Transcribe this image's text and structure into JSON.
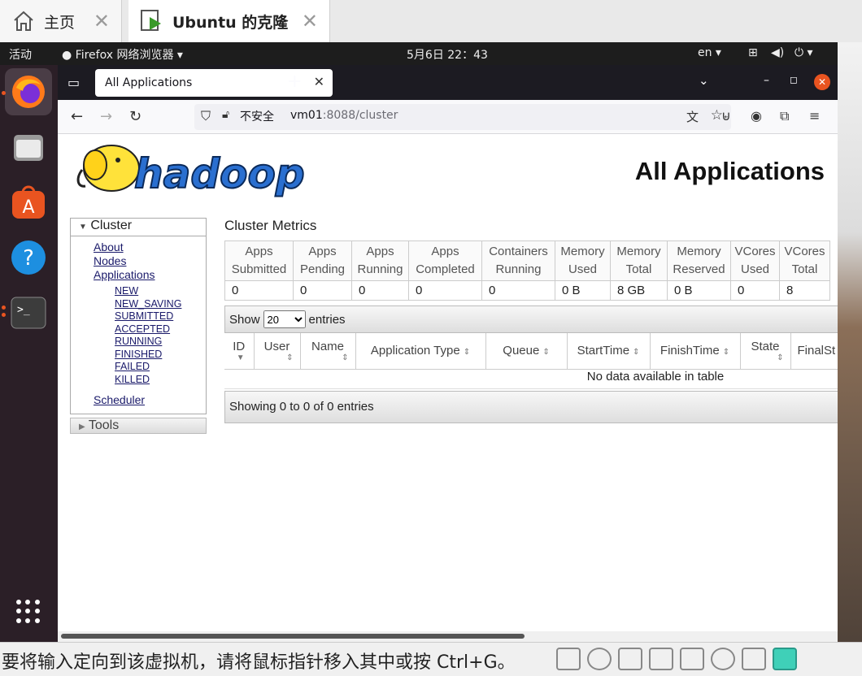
{
  "vm_tabs": [
    {
      "label": "主页"
    },
    {
      "label": "Ubuntu 的克隆"
    }
  ],
  "topbar": {
    "activities": "活动",
    "app_menu": "Firefox 网络浏览器 ▾",
    "clock": "5月6日  22：43",
    "lang": "en ▾"
  },
  "browser": {
    "tab_title": "All Applications",
    "security_label": "不安全",
    "url_host": "vm01",
    "url_rest": ":8088/cluster"
  },
  "page": {
    "title": "All Applications",
    "logo_text": "hadoop"
  },
  "sidebar": {
    "cluster_label": "Cluster",
    "links": [
      "About",
      "Nodes",
      "Applications"
    ],
    "states": [
      "NEW",
      "NEW_SAVING",
      "SUBMITTED",
      "ACCEPTED",
      "RUNNING",
      "FINISHED",
      "FAILED",
      "KILLED"
    ],
    "scheduler": "Scheduler",
    "tools_label": "Tools"
  },
  "metrics": {
    "title": "Cluster Metrics",
    "headers": [
      [
        "Apps",
        "Submitted"
      ],
      [
        "Apps",
        "Pending"
      ],
      [
        "Apps",
        "Running"
      ],
      [
        "Apps",
        "Completed"
      ],
      [
        "Containers",
        "Running"
      ],
      [
        "Memory",
        "Used"
      ],
      [
        "Memory",
        "Total"
      ],
      [
        "Memory",
        "Reserved"
      ],
      [
        "VCores",
        "Used"
      ],
      [
        "VCores",
        "Total"
      ]
    ],
    "values": [
      "0",
      "0",
      "0",
      "0",
      "0",
      "0 B",
      "8 GB",
      "0 B",
      "0",
      "8"
    ]
  },
  "apps_table": {
    "show_label": "Show",
    "entries_value": "20",
    "entries_label": "entries",
    "columns": [
      "ID",
      "User",
      "Name",
      "Application Type",
      "Queue",
      "StartTime",
      "FinishTime",
      "State",
      "FinalSt"
    ],
    "empty_text": "No data available in table",
    "footer": "Showing 0 to 0 of 0 entries"
  },
  "statusbar": {
    "message": "要将输入定向到该虚拟机，请将鼠标指针移入其中或按 Ctrl+G。"
  }
}
